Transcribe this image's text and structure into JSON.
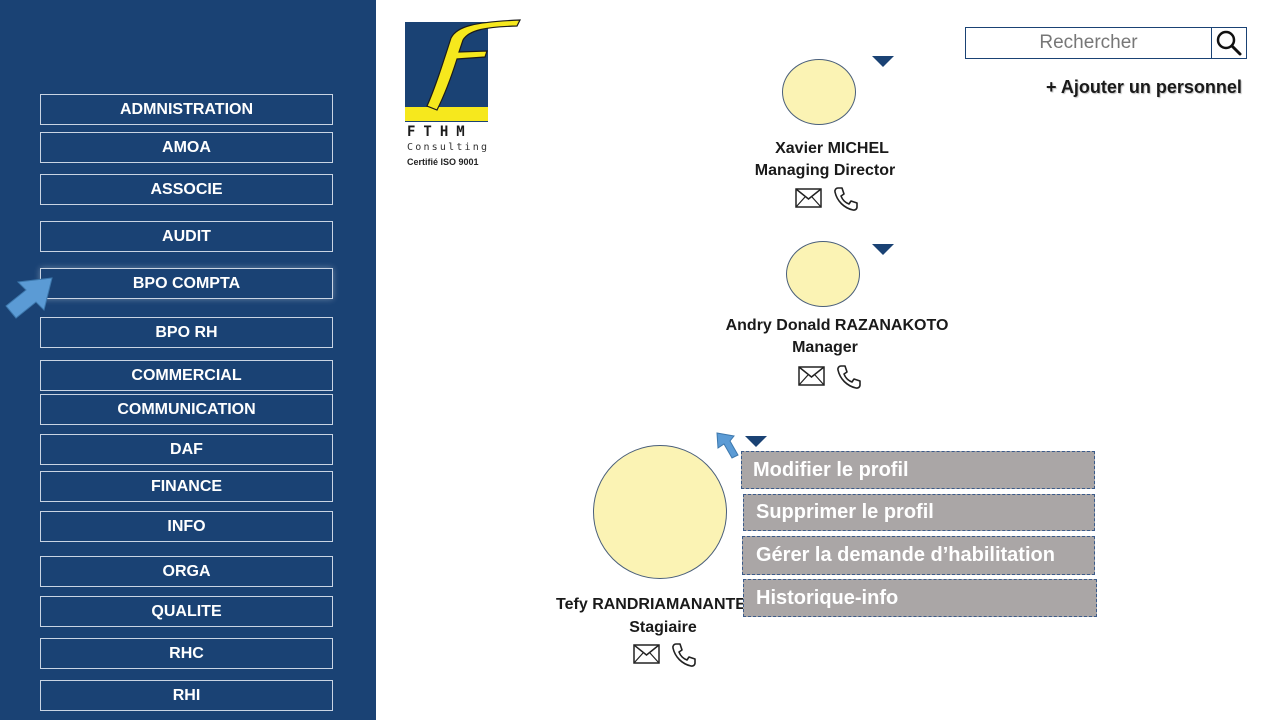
{
  "sidebar": {
    "items": [
      {
        "label": "ADMNISTRATION"
      },
      {
        "label": "AMOA"
      },
      {
        "label": "ASSOCIE"
      },
      {
        "label": "AUDIT"
      },
      {
        "label": "BPO COMPTA"
      },
      {
        "label": "BPO RH"
      },
      {
        "label": "COMMERCIAL"
      },
      {
        "label": "COMMUNICATION"
      },
      {
        "label": "DAF"
      },
      {
        "label": "FINANCE"
      },
      {
        "label": "INFO"
      },
      {
        "label": "ORGA"
      },
      {
        "label": "QUALITE"
      },
      {
        "label": "RHC"
      },
      {
        "label": "RHI"
      }
    ]
  },
  "logo": {
    "letter": "F",
    "name": "FTHM",
    "subtitle": "Consulting",
    "certification": "Certifié ISO 9001"
  },
  "search": {
    "placeholder": "Rechercher",
    "icon": "search-icon"
  },
  "add_person": "+ Ajouter un personnel",
  "people": [
    {
      "name": "Xavier MICHEL",
      "role": "Managing Director"
    },
    {
      "name": "Andry Donald RAZANAKOTO",
      "role": "Manager"
    },
    {
      "name": "Tefy RANDRIAMANANTE",
      "role": "Stagiaire"
    }
  ],
  "context_menu": {
    "items": [
      {
        "label": "Modifier le profil"
      },
      {
        "label": "Supprimer le profil"
      },
      {
        "label": "Gérer la demande d’habilitation"
      },
      {
        "label": "Historique-info"
      }
    ]
  },
  "colors": {
    "sidebar": "#1a4274",
    "avatar_fill": "#fbf3b4",
    "menu_bg": "#aaa6a6",
    "logo_yellow": "#f6e81d"
  }
}
